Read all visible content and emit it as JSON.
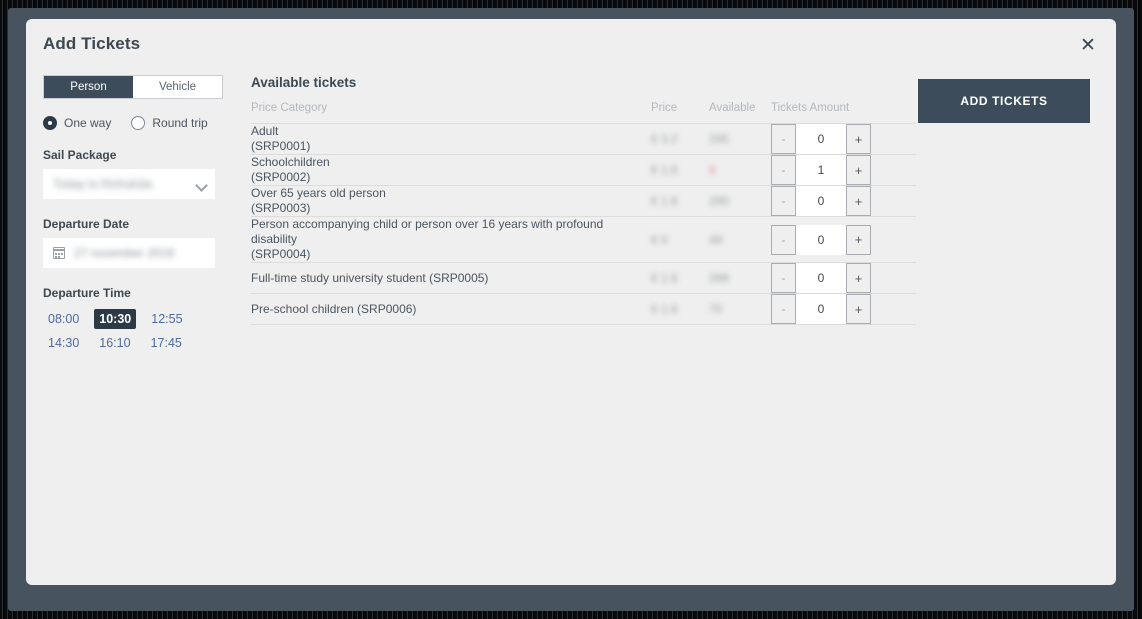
{
  "dialog": {
    "title": "Add Tickets",
    "close_icon": "close-icon"
  },
  "left_panel": {
    "mode_toggle": {
      "options": [
        "Person",
        "Vehicle"
      ],
      "selected": "Person"
    },
    "trip_type": {
      "options": [
        "One way",
        "Round trip"
      ],
      "selected": "One way"
    },
    "sail_package": {
      "label": "Sail Package",
      "value": "Today to Rohuküla",
      "chevron_icon": "chevron-down-icon"
    },
    "departure_date": {
      "label": "Departure Date",
      "value": "27 november 2019",
      "calendar_icon": "calendar-icon"
    },
    "departure_time": {
      "label": "Departure Time",
      "options": [
        "08:00",
        "10:30",
        "12:55",
        "14:30",
        "16:10",
        "17:45"
      ],
      "selected": "10:30"
    }
  },
  "tickets": {
    "heading": "Available tickets",
    "columns": {
      "category": "Price Category",
      "price": "Price",
      "available": "Available",
      "amount": "Tickets Amount"
    },
    "rows": [
      {
        "name": "Adult",
        "code": "(SRP0001)",
        "inline": false,
        "price": "€ 3.2",
        "available": "295",
        "available_low": false,
        "quantity": "0"
      },
      {
        "name": "Schoolchildren",
        "code": "(SRP0002)",
        "inline": false,
        "price": "€ 1.6",
        "available": "8",
        "available_low": true,
        "quantity": "1"
      },
      {
        "name": "Over 65 years old person",
        "code": "(SRP0003)",
        "inline": false,
        "price": "€ 1.6",
        "available": "290",
        "available_low": false,
        "quantity": "0"
      },
      {
        "name": "Person accompanying child or person over 16 years with profound disability",
        "code": "(SRP0004)",
        "inline": false,
        "price": "€ 0",
        "available": "49",
        "available_low": false,
        "quantity": "0"
      },
      {
        "name": "Full-time study university student (SRP0005)",
        "code": "",
        "inline": true,
        "price": "€ 1.6",
        "available": "288",
        "available_low": false,
        "quantity": "0"
      },
      {
        "name": "Pre-school children (SRP0006)",
        "code": "",
        "inline": true,
        "price": "€ 1.6",
        "available": "70",
        "available_low": false,
        "quantity": "0"
      }
    ],
    "stepper": {
      "decrement_label": "-",
      "increment_label": "+"
    }
  },
  "actions": {
    "add_tickets_label": "ADD TICKETS"
  },
  "colors": {
    "accent": "#3d4c5a",
    "link": "#4b6b9c",
    "background": "#efefef",
    "backdrop": "#47545f",
    "low_availability": "#e58a96"
  }
}
